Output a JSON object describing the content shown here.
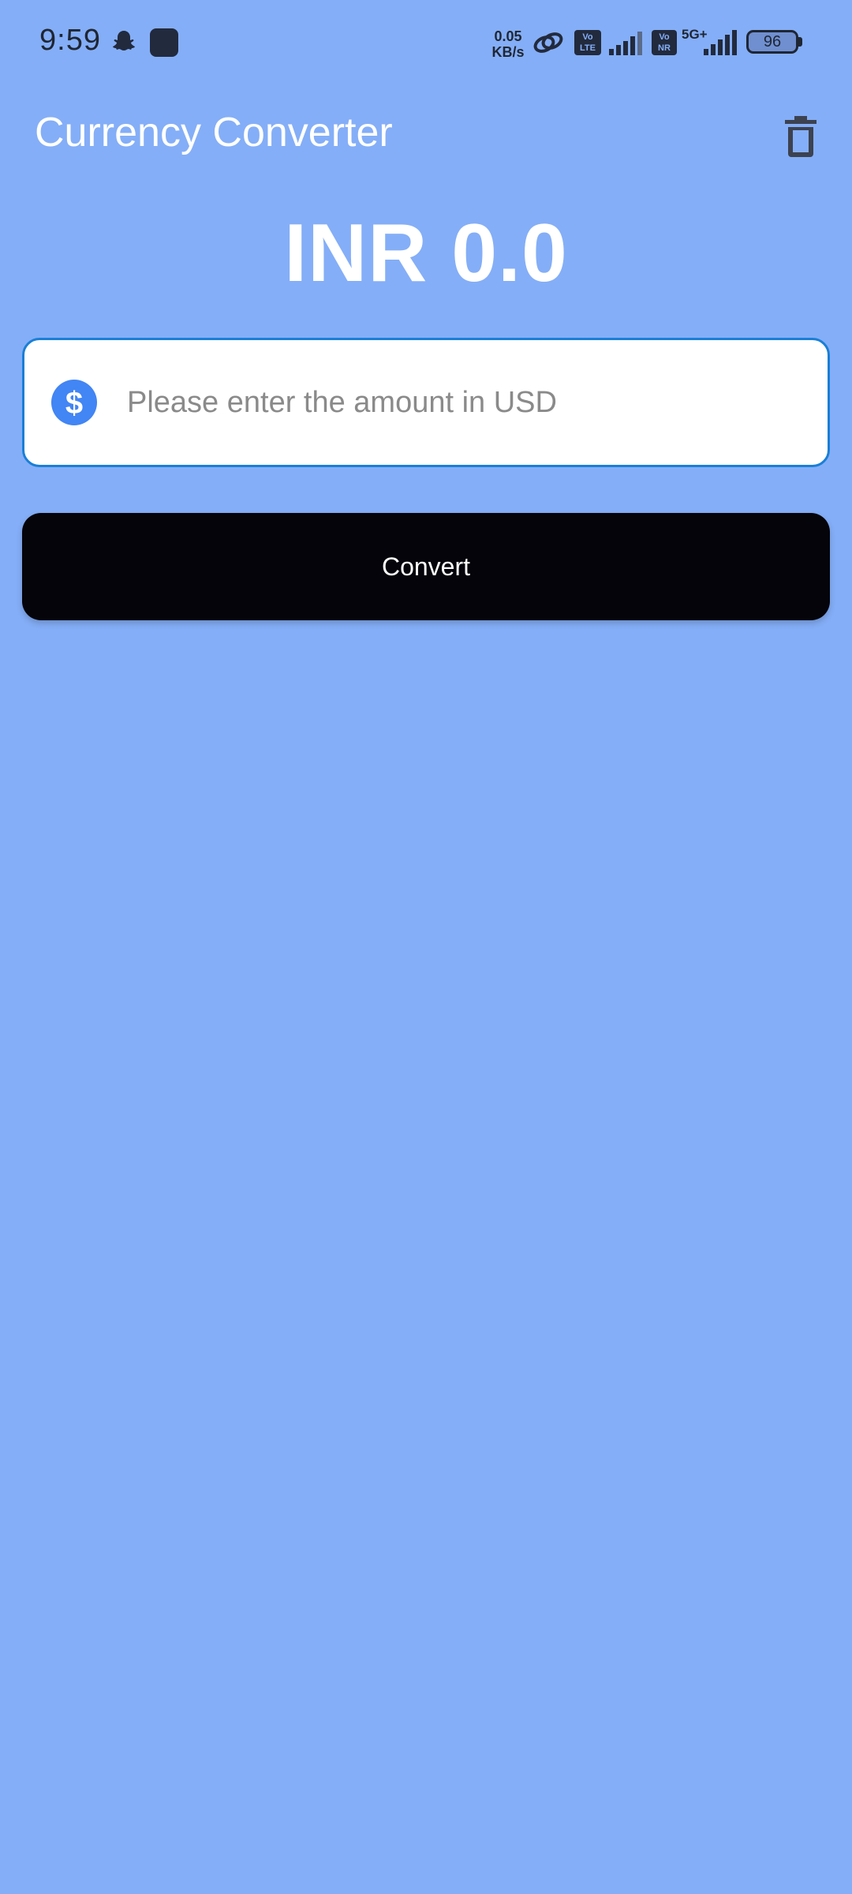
{
  "status_bar": {
    "time": "9:59",
    "net_speed_value": "0.05",
    "net_speed_unit": "KB/s",
    "volte_line1": "Vo",
    "volte_line2": "LTE",
    "vonr_line1": "Vo",
    "vonr_line2": "NR",
    "network_gen": "5G+",
    "battery_level": "96"
  },
  "app_bar": {
    "title": "Currency Converter",
    "delete_icon": "trash-icon"
  },
  "result": {
    "text": "INR 0.0"
  },
  "amount_input": {
    "placeholder": "Please enter the amount in USD",
    "value": "",
    "icon": "dollar-circle-icon"
  },
  "convert_button": {
    "label": "Convert"
  },
  "colors": {
    "background": "#84AEF7",
    "accent": "#1a7fd6",
    "icon_blue": "#4285F4",
    "button": "#05040a"
  }
}
